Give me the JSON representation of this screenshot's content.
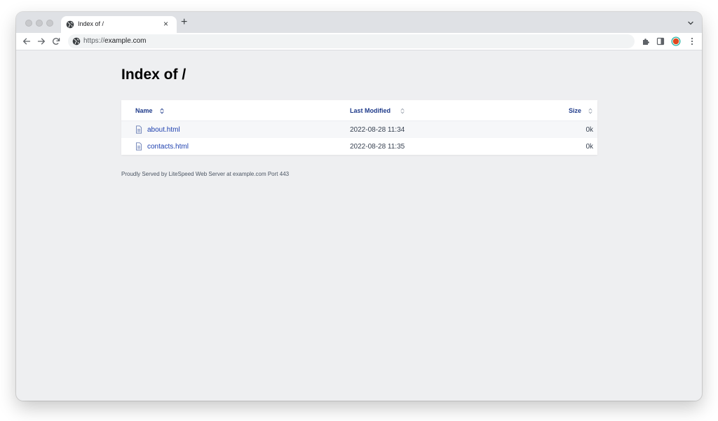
{
  "browser": {
    "tab": {
      "title": "Index of /",
      "close_glyph": "×",
      "icon": "globe-icon"
    },
    "new_tab_glyph": "+",
    "address": {
      "scheme": "https://",
      "host": "example.com",
      "icon": "site-info-icon"
    },
    "toolbar_icons": [
      "back-icon",
      "forward-icon",
      "reload-icon",
      "extensions-icon",
      "side-panel-icon",
      "profile-icon",
      "menu-icon"
    ],
    "colors": {
      "profile_ring": "#2bb5a7",
      "profile_fill": "#e0481f"
    }
  },
  "page": {
    "title": "Index of /",
    "columns": {
      "name": "Name",
      "modified": "Last Modified",
      "size": "Size"
    },
    "rows": [
      {
        "name": "about.html",
        "modified": "2022-08-28 11:34",
        "size": "0k"
      },
      {
        "name": "contacts.html",
        "modified": "2022-08-28 11:35",
        "size": "0k"
      }
    ],
    "footer": "Proudly Served by LiteSpeed Web Server at example.com Port 443",
    "colors": {
      "link": "#1e40af",
      "header": "#1e3a8a",
      "background": "#eeeff1"
    }
  }
}
